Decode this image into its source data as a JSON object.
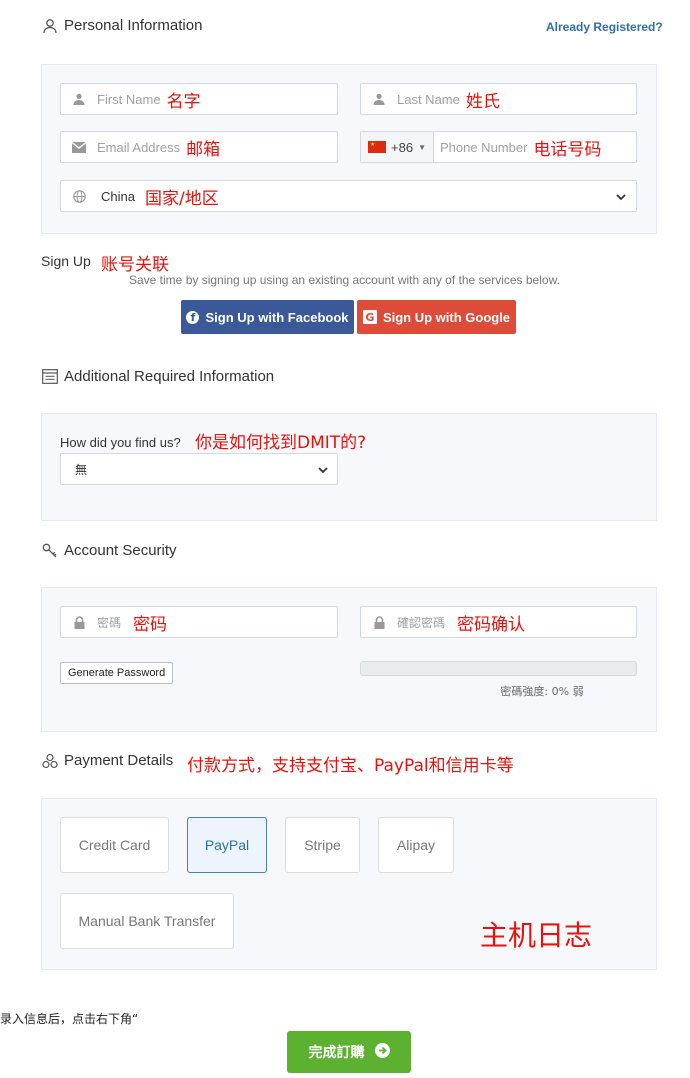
{
  "personal": {
    "title": "Personal Information",
    "already_registered": "Already Registered?",
    "first_name_ph": "First Name",
    "first_name_ann": "名字",
    "last_name_ph": "Last Name",
    "last_name_ann": "姓氏",
    "email_ph": "Email Address",
    "email_ann": "邮箱",
    "phone_code": "+86",
    "phone_ph": "Phone Number",
    "phone_ann": "电话号码",
    "country_value": "China",
    "country_ann": "国家/地区"
  },
  "signup": {
    "title": "Sign Up",
    "ann": "账号关联",
    "desc": "Save time by signing up using an existing account with any of the services below.",
    "facebook_label": "Sign Up with Facebook",
    "google_label": "Sign Up with Google"
  },
  "additional": {
    "title": "Additional Required Information",
    "question": "How did you find us?",
    "question_ann": "你是如何找到DMIT的?",
    "select_value": "無"
  },
  "security": {
    "title": "Account Security",
    "password_ph": "密碼",
    "password_ann": "密码",
    "confirm_ph": "確認密碼",
    "confirm_ann": "密码确认",
    "generate_label": "Generate Password",
    "strength_text": "密碼強度: 0% 弱",
    "strength_value": 0
  },
  "payment": {
    "title": "Payment Details",
    "ann": "付款方式，支持支付宝、PayPal和信用卡等",
    "methods": [
      "Credit Card",
      "PayPal",
      "Stripe",
      "Alipay",
      "Manual Bank Transfer"
    ],
    "selected": "PayPal",
    "panel_ann": "主机日志"
  },
  "footer": {
    "note": "录入信息后，点击右下角“",
    "submit_label": "完成訂購"
  },
  "colors": {
    "facebook": "#3b5998",
    "google": "#dd4b39",
    "submit": "#5cb130",
    "link": "#2f6ea8",
    "annotation": "#e8120c"
  }
}
